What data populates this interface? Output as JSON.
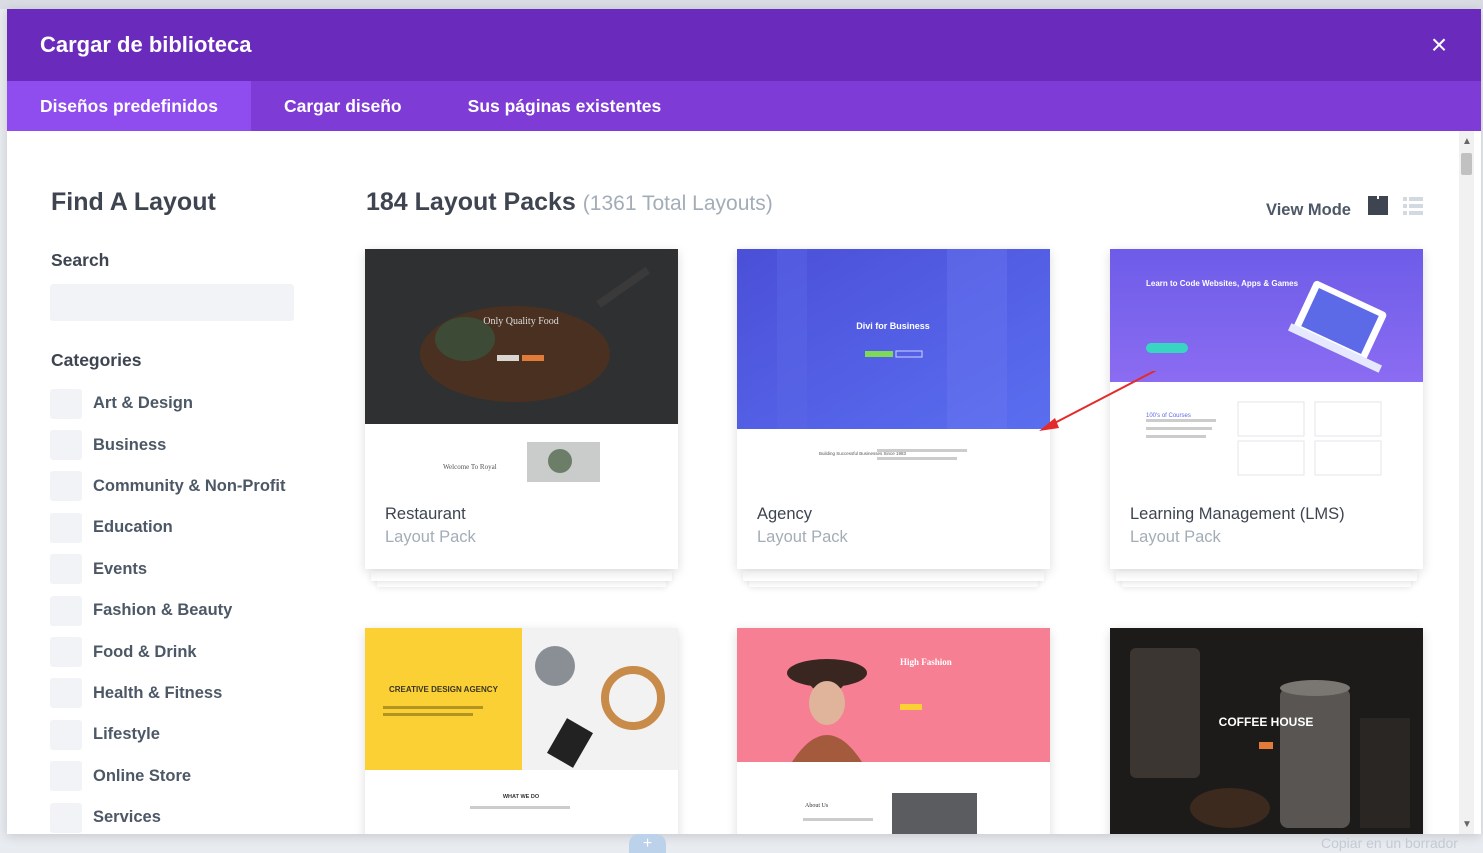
{
  "modal": {
    "title": "Cargar de biblioteca",
    "close_symbol": "×"
  },
  "tabs": [
    {
      "label": "Diseños predefinidos",
      "active": true
    },
    {
      "label": "Cargar diseño",
      "active": false
    },
    {
      "label": "Sus páginas existentes",
      "active": false
    }
  ],
  "sidebar": {
    "title": "Find A Layout",
    "search_label": "Search",
    "search_value": "",
    "categories_label": "Categories",
    "categories": [
      "Art & Design",
      "Business",
      "Community & Non-Profit",
      "Education",
      "Events",
      "Fashion & Beauty",
      "Food & Drink",
      "Health & Fitness",
      "Lifestyle",
      "Online Store",
      "Services"
    ]
  },
  "main": {
    "packs_title": "184 Layout Packs",
    "packs_count": "(1361 Total Layouts)",
    "view_mode_label": "View Mode",
    "cards": [
      {
        "name": "Restaurant",
        "sub": "Layout Pack",
        "thumb_text": "Only Quality Food",
        "thumb_text2": "Welcome To Royal"
      },
      {
        "name": "Agency",
        "sub": "Layout Pack",
        "thumb_text": "Divi for Business",
        "thumb_text2": "Building Successful Businesses Since 1983"
      },
      {
        "name": "Learning Management (LMS)",
        "sub": "Layout Pack",
        "thumb_text": "Learn to Code Websites, Apps & Games",
        "thumb_text2": "100's of Courses"
      },
      {
        "thumb_text": "CREATIVE DESIGN AGENCY",
        "thumb_text2": "WHAT WE DO"
      },
      {
        "thumb_text": "High Fashion",
        "thumb_text2": "About Us"
      },
      {
        "thumb_text": "COFFEE HOUSE"
      }
    ]
  },
  "footer": {
    "add_symbol": "+",
    "draft_text": "Copiar en un borrador"
  },
  "colors": {
    "header": "#6a2bbc",
    "tabs": "#7e3bd6",
    "active_tab": "#8f4cee",
    "annotation": "#e52a2a"
  }
}
